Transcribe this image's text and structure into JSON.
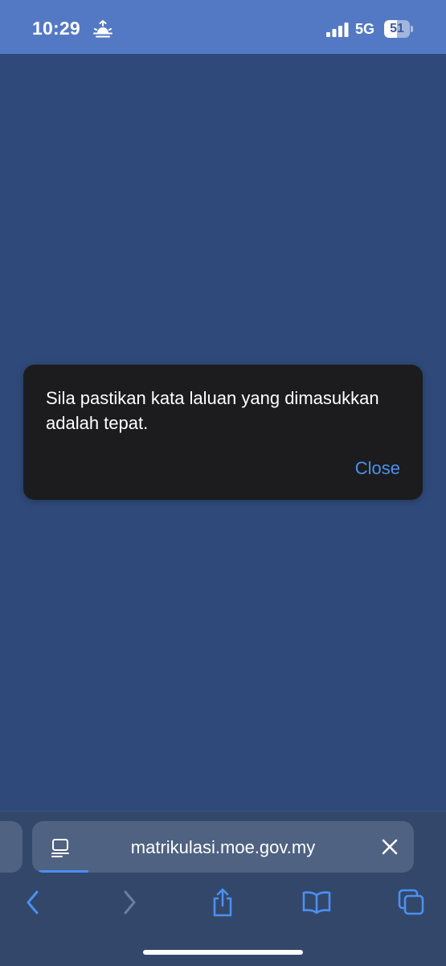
{
  "status_bar": {
    "time": "10:29",
    "network": "5G",
    "battery_percent": 51,
    "battery_label": "51",
    "time_icon": "sunrise-icon",
    "signal_icon": "cellular-signal-icon"
  },
  "alert": {
    "message": "Sila pastikan kata laluan yang dimasukkan adalah tepat.",
    "close_label": "Close"
  },
  "browser": {
    "url": "matrikulasi.moe.gov.my",
    "page_icon": "reader-mode-icon",
    "clear_icon": "close-icon",
    "load_progress": 0.13,
    "toolbar": {
      "back_icon": "chevron-left-icon",
      "forward_icon": "chevron-right-icon",
      "share_icon": "share-icon",
      "bookmarks_icon": "book-icon",
      "tabs_icon": "tabs-icon",
      "forward_enabled": false
    }
  },
  "colors": {
    "background": "#2f4a7a",
    "status_bar": "#5479c4",
    "dialog": "#1c1c1e",
    "accent": "#4a90f0"
  }
}
